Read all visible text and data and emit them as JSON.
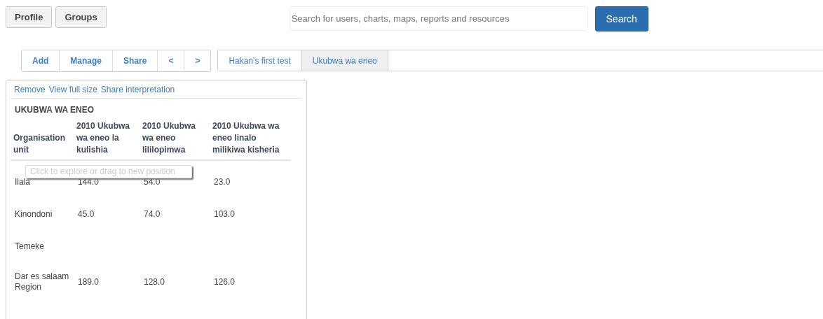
{
  "top_buttons": [
    "Profile",
    "Groups"
  ],
  "search": {
    "placeholder": "Search for users, charts, maps, reports and resources",
    "button": "Search"
  },
  "toolbar": [
    "Add",
    "Manage",
    "Share",
    "<",
    ">"
  ],
  "tabs": [
    {
      "label": "Hakan's first test",
      "selected": false
    },
    {
      "label": "Ukubwa wa eneo",
      "selected": true
    }
  ],
  "panel": {
    "links": [
      "Remove",
      "View full size",
      "Share interpretation"
    ],
    "title": "UKUBWA WA ENEO",
    "columns": [
      "Organisation unit",
      "2010 Ukubwa wa eneo la kulishia",
      "2010 Ukubwa wa eneo lililopimwa",
      "2010 Ukubwa wa eneo linalo milikiwa kisheria"
    ],
    "rows": [
      {
        "cells": [
          "Ilala",
          "144.0",
          "54.0",
          "23.0"
        ]
      },
      {
        "cells": [
          "Kinondoni",
          "45.0",
          "74.0",
          "103.0"
        ]
      },
      {
        "cells": [
          "Temeke"
        ]
      },
      {
        "cells": [
          "Dar es salaam Region",
          "189.0",
          "128.0",
          "126.0"
        ]
      }
    ],
    "tooltip": "Click to explore or drag to new position"
  }
}
